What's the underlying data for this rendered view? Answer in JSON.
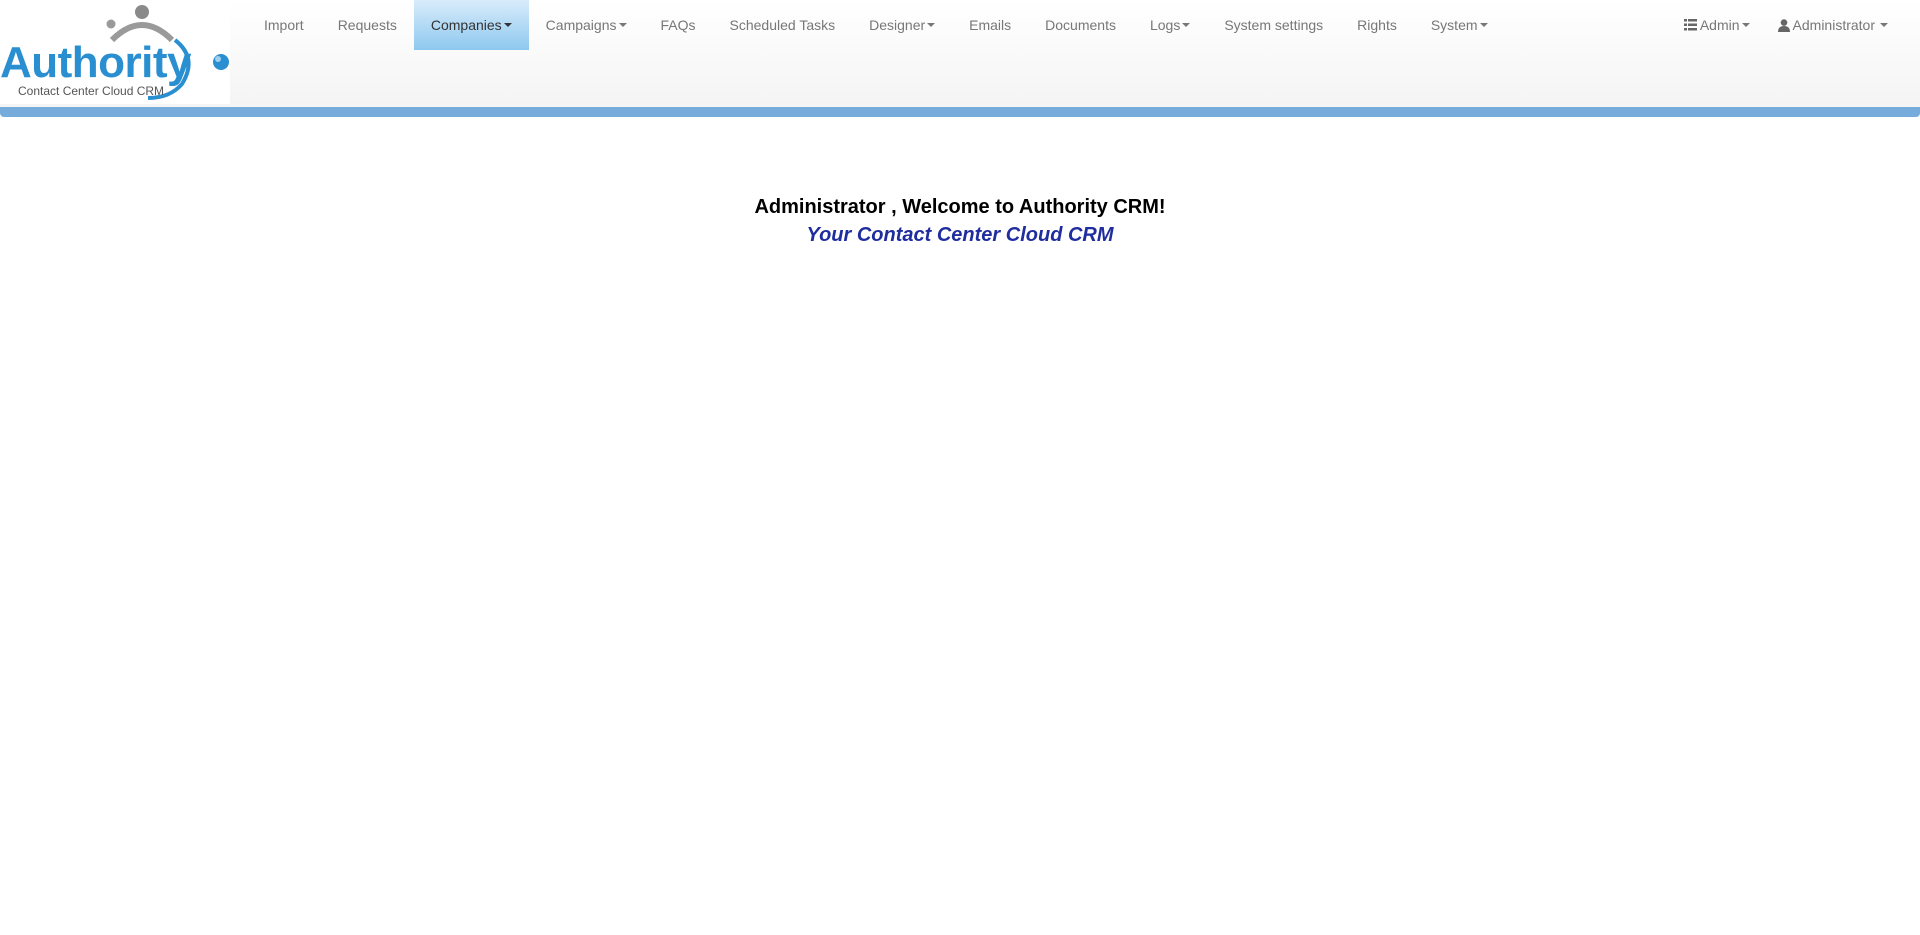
{
  "brand": {
    "logo_text": "Authority",
    "tagline": "Contact Center Cloud CRM"
  },
  "nav": {
    "items": [
      {
        "label": "Import",
        "dropdown": false,
        "active": false
      },
      {
        "label": "Requests",
        "dropdown": false,
        "active": false
      },
      {
        "label": "Companies",
        "dropdown": true,
        "active": true
      },
      {
        "label": "Campaigns",
        "dropdown": true,
        "active": false
      },
      {
        "label": "FAQs",
        "dropdown": false,
        "active": false
      },
      {
        "label": "Scheduled Tasks",
        "dropdown": false,
        "active": false
      },
      {
        "label": "Designer",
        "dropdown": true,
        "active": false
      },
      {
        "label": "Emails",
        "dropdown": false,
        "active": false
      },
      {
        "label": "Documents",
        "dropdown": false,
        "active": false
      },
      {
        "label": "Logs",
        "dropdown": true,
        "active": false
      },
      {
        "label": "System settings",
        "dropdown": false,
        "active": false
      },
      {
        "label": "Rights",
        "dropdown": false,
        "active": false
      },
      {
        "label": "System",
        "dropdown": true,
        "active": false
      }
    ],
    "right": {
      "admin_menu": {
        "label": "Admin",
        "icon": "list-icon"
      },
      "user_menu": {
        "label": "Administrator",
        "icon": "user-icon"
      }
    }
  },
  "welcome": {
    "title": "Administrator , Welcome to Authority CRM!",
    "subtitle": "Your Contact Center Cloud CRM"
  },
  "colors": {
    "brand_blue": "#2a8fd0",
    "nav_bar_bottom": "#75acdc",
    "active_tab": "#8ec8ef",
    "subtitle": "#1f2d9e"
  }
}
